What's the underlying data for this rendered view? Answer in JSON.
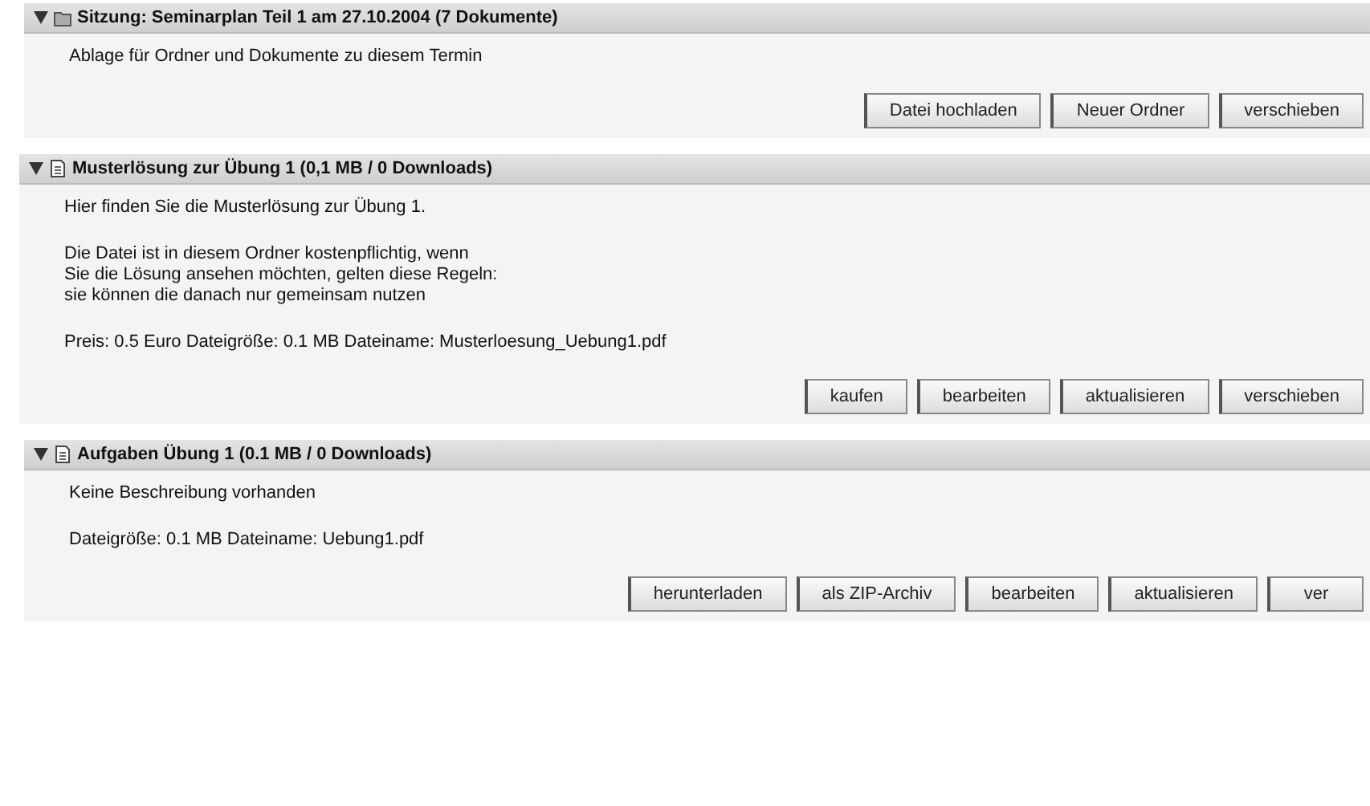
{
  "sections": [
    {
      "kind": "folder",
      "title": "Sitzung: Seminarplan Teil 1 am 27.10.2004 (7 Dokumente)",
      "expanded": true,
      "paragraphs": [
        [
          "Ablage für Ordner und Dokumente zu diesem Termin"
        ]
      ],
      "buttons": [
        "Datei hochladen",
        "Neuer Ordner",
        "verschieben"
      ]
    },
    {
      "kind": "file",
      "title": "Musterlösung zur Übung 1 (0,1 MB / 0 Downloads)",
      "expanded": true,
      "paragraphs": [
        [
          "Hier finden Sie die Musterlösung zur Übung 1."
        ],
        [
          "Die Datei ist in diesem Ordner kostenpflichtig, wenn",
          "Sie die Lösung ansehen möchten, gelten diese Regeln:",
          "sie können die danach nur gemeinsam nutzen"
        ],
        [
          "Preis: 0.5 Euro  Dateigröße: 0.1 MB  Dateiname: Musterloesung_Uebung1.pdf"
        ]
      ],
      "buttons": [
        "kaufen",
        "bearbeiten",
        "aktualisieren",
        "verschieben"
      ]
    },
    {
      "kind": "file",
      "title": "Aufgaben Übung 1 (0.1 MB / 0 Downloads)",
      "expanded": true,
      "paragraphs": [
        [
          "Keine Beschreibung vorhanden"
        ],
        [
          "Dateigröße: 0.1 MB  Dateiname: Uebung1.pdf"
        ]
      ],
      "buttons": [
        "herunterladen",
        "als ZIP-Archiv",
        "bearbeiten",
        "aktualisieren",
        "ver"
      ]
    }
  ]
}
